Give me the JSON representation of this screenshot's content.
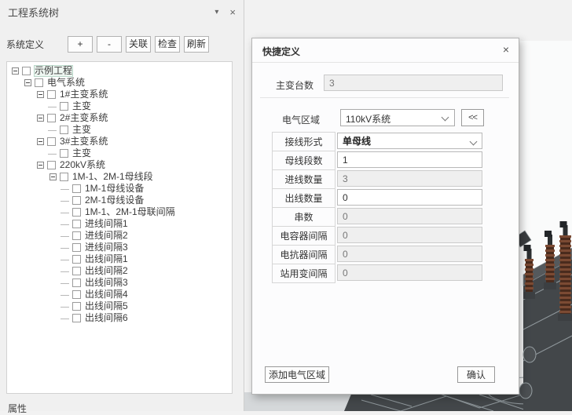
{
  "panel": {
    "title": "工程系统树",
    "collapse_icon": "▾",
    "close_icon": "×",
    "toolbar": {
      "label": "系统定义",
      "buttons": [
        "+",
        "-",
        "关联",
        "检查",
        "刷新"
      ]
    },
    "tree": [
      {
        "label": "示例工程",
        "level": 0,
        "branch": true,
        "highlight": true
      },
      {
        "label": "电气系统",
        "level": 1,
        "branch": true
      },
      {
        "label": "1#主变系统",
        "level": 2,
        "branch": true
      },
      {
        "label": "主变",
        "level": 3,
        "branch": false
      },
      {
        "label": "2#主变系统",
        "level": 2,
        "branch": true
      },
      {
        "label": "主变",
        "level": 3,
        "branch": false
      },
      {
        "label": "3#主变系统",
        "level": 2,
        "branch": true
      },
      {
        "label": "主变",
        "level": 3,
        "branch": false
      },
      {
        "label": "220kV系统",
        "level": 2,
        "branch": true
      },
      {
        "label": "1M-1、2M-1母线段",
        "level": 3,
        "branch": true
      },
      {
        "label": "1M-1母线设备",
        "level": 4,
        "branch": false
      },
      {
        "label": "2M-1母线设备",
        "level": 4,
        "branch": false
      },
      {
        "label": "1M-1、2M-1母联间隔",
        "level": 4,
        "branch": false
      },
      {
        "label": "进线间隔1",
        "level": 4,
        "branch": false
      },
      {
        "label": "进线间隔2",
        "level": 4,
        "branch": false
      },
      {
        "label": "进线间隔3",
        "level": 4,
        "branch": false
      },
      {
        "label": "出线间隔1",
        "level": 4,
        "branch": false
      },
      {
        "label": "出线间隔2",
        "level": 4,
        "branch": false
      },
      {
        "label": "出线间隔3",
        "level": 4,
        "branch": false
      },
      {
        "label": "出线间隔4",
        "level": 4,
        "branch": false
      },
      {
        "label": "出线间隔5",
        "level": 4,
        "branch": false
      },
      {
        "label": "出线间隔6",
        "level": 4,
        "branch": false
      }
    ],
    "bottom_tab": "属性"
  },
  "dialog": {
    "title": "快捷定义",
    "close_icon": "×",
    "transformer_count": {
      "label": "主变台数",
      "value": "3"
    },
    "region": {
      "label": "电气区域",
      "value": "110kV系统",
      "collapse_button": "<<"
    },
    "rows": [
      {
        "label": "接线形式",
        "value": "单母线",
        "state": "dropdown"
      },
      {
        "label": "母线段数",
        "value": "1",
        "state": "enabled"
      },
      {
        "label": "进线数量",
        "value": "3",
        "state": "disabled"
      },
      {
        "label": "出线数量",
        "value": "0",
        "state": "enabled"
      },
      {
        "label": "串数",
        "value": "0",
        "state": "disabled"
      },
      {
        "label": "电容器间隔",
        "value": "0",
        "state": "disabled"
      },
      {
        "label": "电抗器间隔",
        "value": "0",
        "state": "disabled"
      },
      {
        "label": "站用变间隔",
        "value": "0",
        "state": "disabled"
      }
    ],
    "footer": {
      "add_region": "添加电气区域",
      "confirm": "确认"
    }
  },
  "viewport": {
    "description": "3d-cad-substation-model",
    "colors": {
      "model_gray": "#43474a",
      "edge_line": "#8f979b",
      "insulator_brown": "#7b4a33",
      "light_strip": "#d5d8da",
      "viewport_bg": "#fafbfb"
    }
  }
}
